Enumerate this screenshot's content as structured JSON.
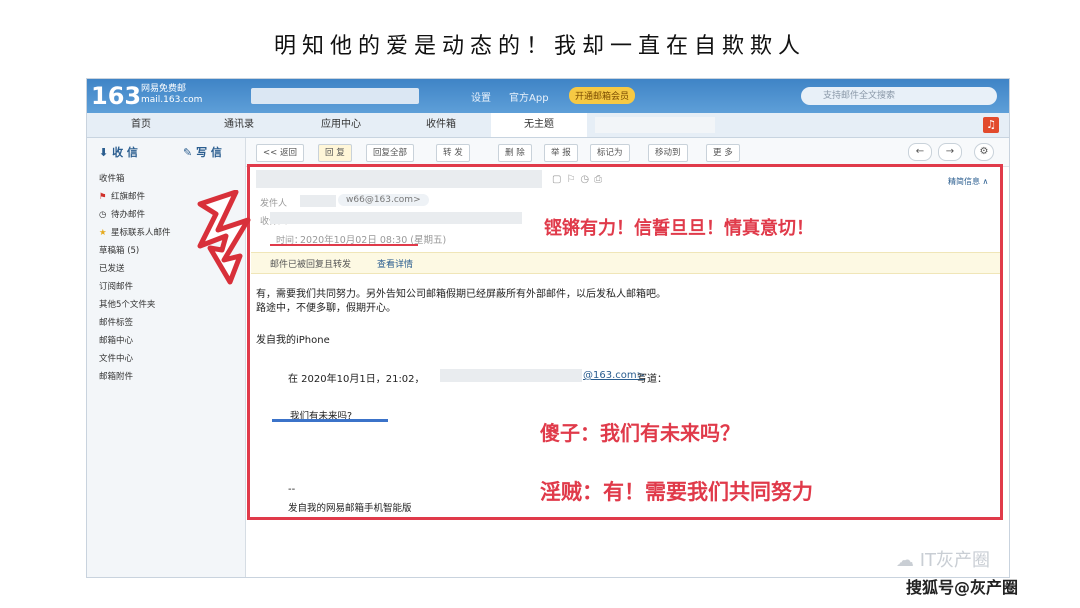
{
  "caption": "明知他的爱是动态的！我却一直在自欺欺人",
  "header": {
    "logo": "163",
    "logo_sub1": "网易免费邮",
    "logo_sub2": "mail.163.com",
    "settings": "设置",
    "official_app": "官方App",
    "vip": "开通邮箱会员",
    "search_placeholder": "支持邮件全文搜索"
  },
  "tabs": [
    "首页",
    "通讯录",
    "应用中心",
    "收件箱",
    "无主题"
  ],
  "sidebar": {
    "receive": "收 信",
    "compose": "写 信",
    "items": [
      "收件箱",
      "红旗邮件",
      "待办邮件",
      "星标联系人邮件",
      "草稿箱 (5)",
      "已发送",
      "订阅邮件",
      "其他5个文件夹",
      "邮件标签",
      "邮箱中心",
      "文件中心",
      "邮箱附件"
    ]
  },
  "toolbar": [
    "<< 返回",
    "回 复",
    "回复全部",
    "转 发",
    "删 除",
    "举 报",
    "标记为",
    "移动到",
    "更 多"
  ],
  "mail": {
    "sender_label": "发件人",
    "sender_email": "w66@163.com>",
    "recipient_label": "收件人：",
    "time_label": "时间：",
    "date": "2020年10月02日 08:30 (星期五)",
    "tip": "精简信息 ∧",
    "notice": "邮件已被回复且转发",
    "notice_link": "查看详情",
    "line1": "有，需要我们共同努力。另外告知公司邮箱假期已经屏蔽所有外部邮件，以后发私人邮箱吧。",
    "line2": "路途中，不便多聊，假期开心。",
    "line3": "发自我的iPhone",
    "quote_prefix": "在 2020年10月1日，21:02，",
    "quote_email": "@163.com>",
    "quote_suffix": " 写道：",
    "quote_text": "我们有未来吗?",
    "sign_dash": "--",
    "sign": "发自我的网易邮箱手机智能版"
  },
  "annotations": {
    "a1": "铿锵有力！信誓旦旦！情真意切！",
    "a2": "傻子：我们有未来吗？",
    "a3": "淫贼：有！需要我们共同努力"
  },
  "watermark": {
    "wechat": "IT灰产圈",
    "sohu": "搜狐号@灰产圈"
  },
  "colors": {
    "brand": "#3f84c6",
    "annotation": "#e03a4a",
    "underline": "#3b73c9"
  }
}
